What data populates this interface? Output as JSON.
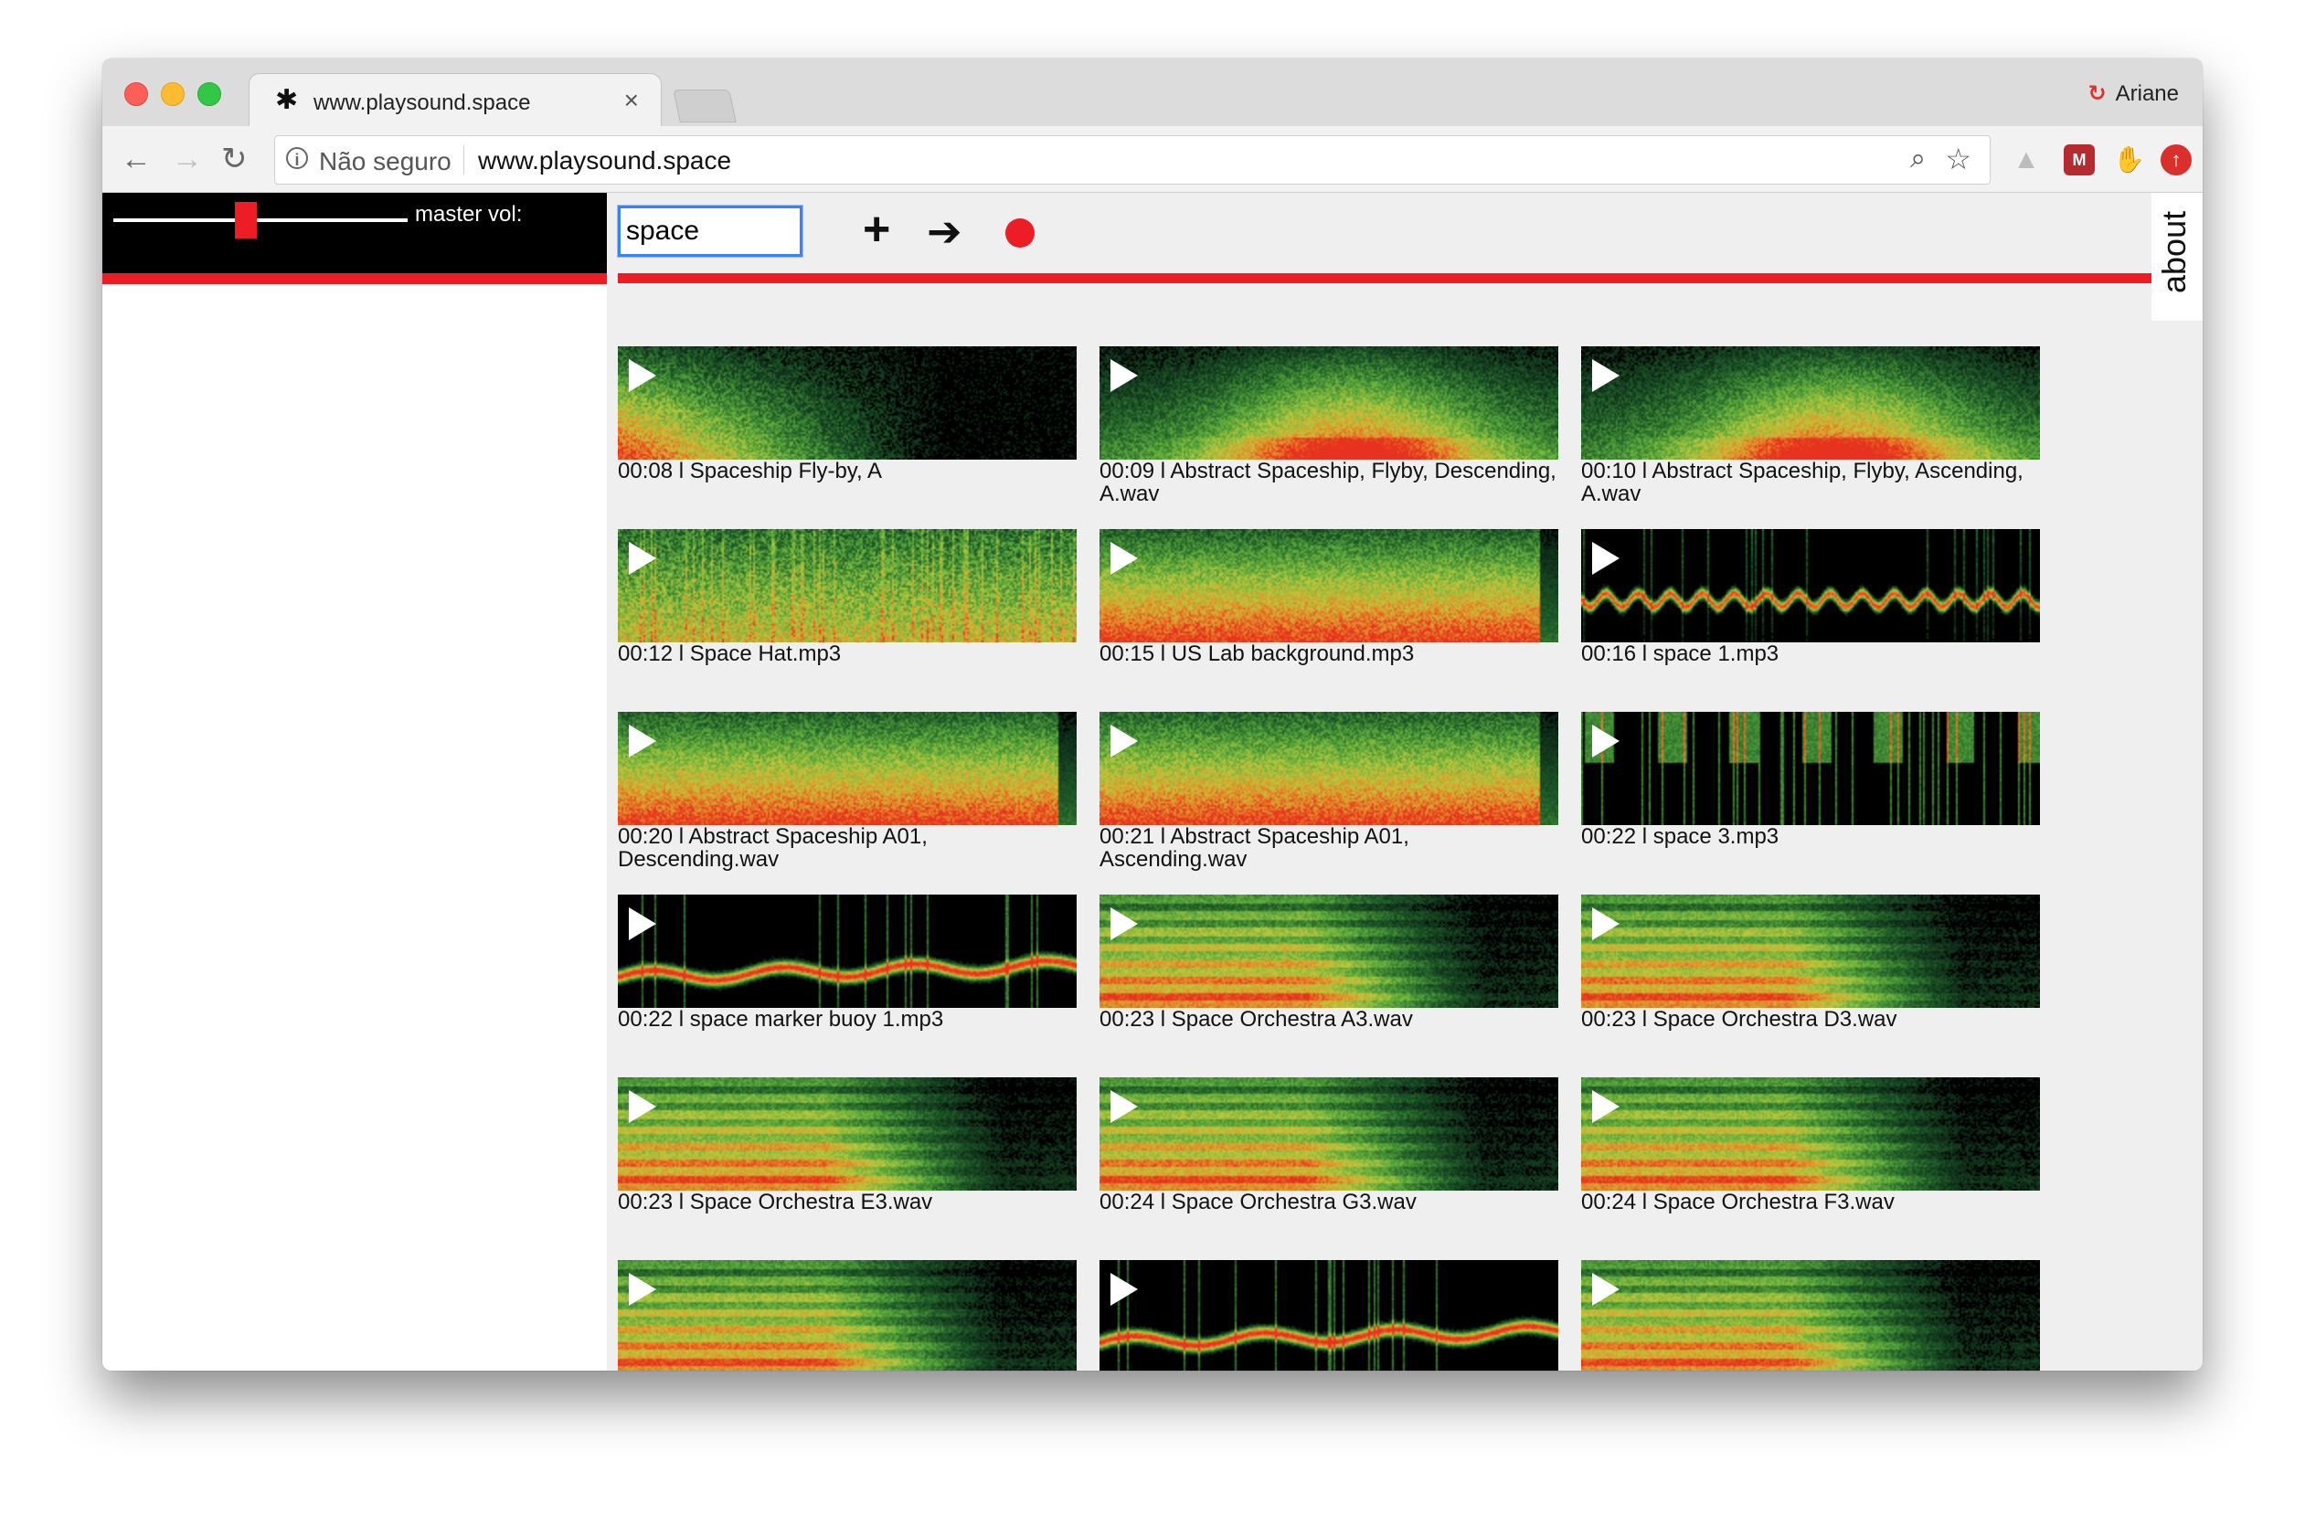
{
  "browser": {
    "tab_title": "www.playsound.space",
    "tab_favicon": "✱",
    "tab_close": "×",
    "profile_name": "Ariane",
    "security_label": "Não seguro",
    "url": "www.playsound.space"
  },
  "player": {
    "master_vol_label": "master vol:",
    "master_vol_level": 0.45,
    "search_value": "space",
    "about_label": "about"
  },
  "colors": {
    "accent_red": "#ee1c25",
    "focus_blue": "#3b82f6"
  },
  "sounds": [
    {
      "caption": "00:08 l Spaceship Fly-by, A",
      "style": "flyby"
    },
    {
      "caption": "00:09 l Abstract Spaceship, Flyby, Descending, A.wav",
      "style": "hump"
    },
    {
      "caption": "00:10 l Abstract Spaceship, Flyby, Ascending, A.wav",
      "style": "hump"
    },
    {
      "caption": "00:12 l Space Hat.mp3",
      "style": "dense"
    },
    {
      "caption": "00:15 l US Lab background.mp3",
      "style": "full"
    },
    {
      "caption": "00:16 l space 1.mp3",
      "style": "wave"
    },
    {
      "caption": "00:20 l Abstract Spaceship A01, Descending.wav",
      "style": "full"
    },
    {
      "caption": "00:21 l Abstract Spaceship A01, Ascending.wav",
      "style": "full"
    },
    {
      "caption": "00:22 l space 3.mp3",
      "style": "bursts"
    },
    {
      "caption": "00:22 l space marker buoy 1.mp3",
      "style": "squiggle"
    },
    {
      "caption": "00:23 l Space Orchestra A3.wav",
      "style": "orchestra"
    },
    {
      "caption": "00:23 l Space Orchestra D3.wav",
      "style": "orchestra"
    },
    {
      "caption": "00:23 l Space Orchestra E3.wav",
      "style": "orchestra"
    },
    {
      "caption": "00:24 l Space Orchestra G3.wav",
      "style": "orchestra"
    },
    {
      "caption": "00:24 l Space Orchestra F3.wav",
      "style": "orchestra"
    },
    {
      "caption": "",
      "style": "orchestra"
    },
    {
      "caption": "",
      "style": "squiggle"
    },
    {
      "caption": "",
      "style": "orchestra"
    }
  ]
}
